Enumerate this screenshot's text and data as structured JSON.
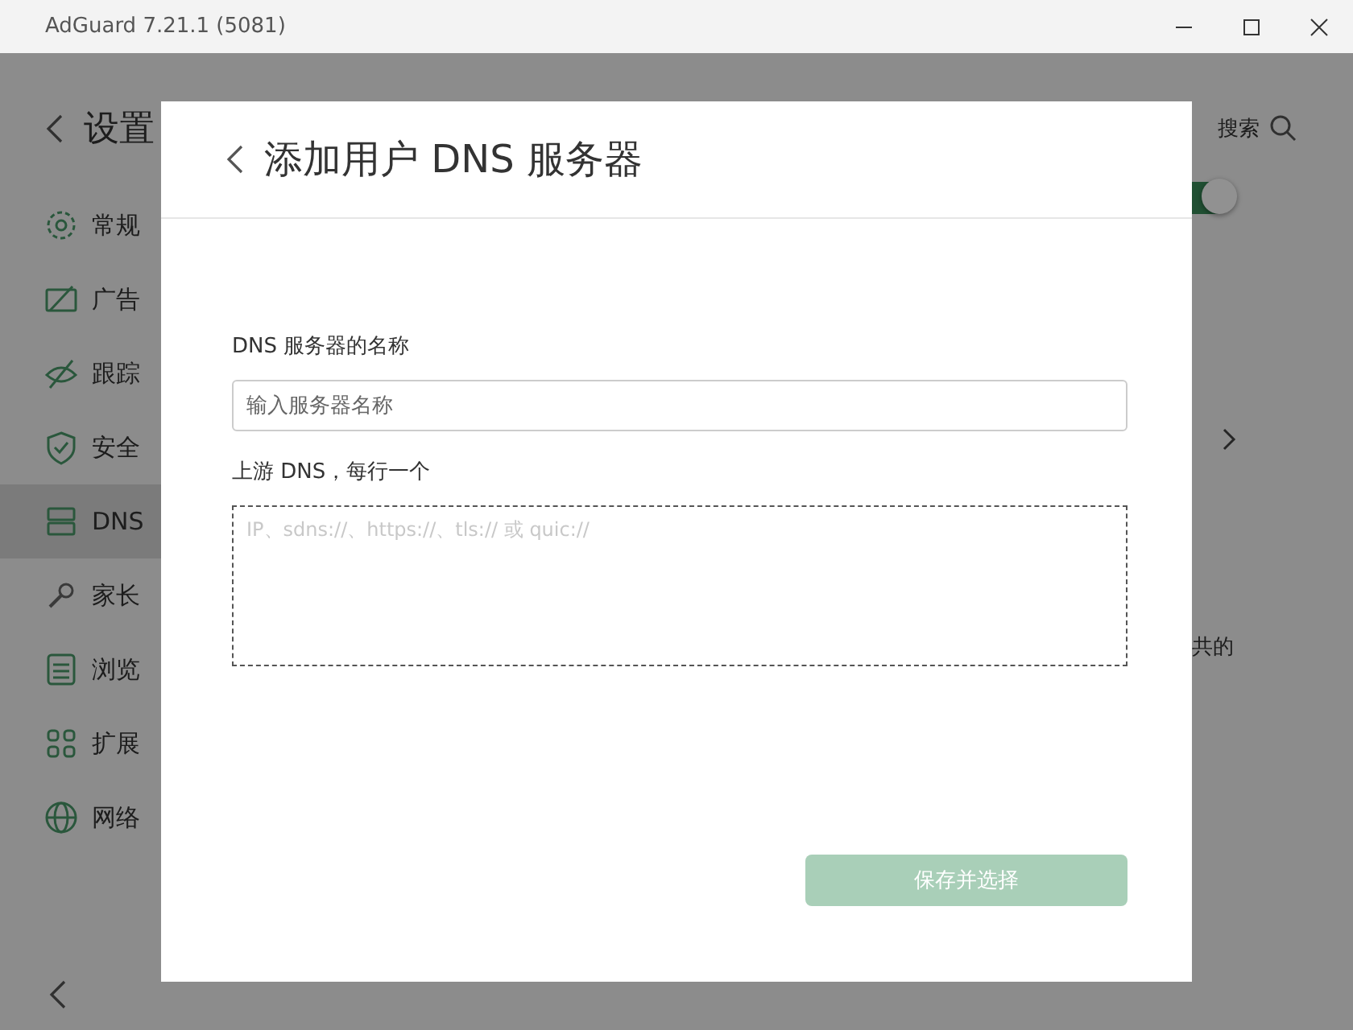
{
  "window": {
    "title": "AdGuard 7.21.1 (5081)"
  },
  "page": {
    "title": "设置",
    "search_label": "搜索",
    "toggle": {
      "on": true
    },
    "note": "共的"
  },
  "sidebar": {
    "items": [
      {
        "label": "常规",
        "selected": false
      },
      {
        "label": "广告",
        "selected": false
      },
      {
        "label": "跟踪",
        "selected": false
      },
      {
        "label": "安全",
        "selected": false
      },
      {
        "label": "DNS",
        "selected": true
      },
      {
        "label": "家长",
        "selected": false
      },
      {
        "label": "浏览",
        "selected": false
      },
      {
        "label": "扩展",
        "selected": false
      },
      {
        "label": "网络",
        "selected": false
      }
    ]
  },
  "dialog": {
    "title": "添加用户 DNS 服务器",
    "name_field": {
      "label": "DNS 服务器的名称",
      "placeholder": "输入服务器名称"
    },
    "upstream_field": {
      "label": "上游 DNS，每行一个",
      "placeholder": "IP、sdns://、https://、tls:// 或 quic://"
    },
    "save_button": {
      "label": "保存并选择",
      "disabled": true
    }
  }
}
